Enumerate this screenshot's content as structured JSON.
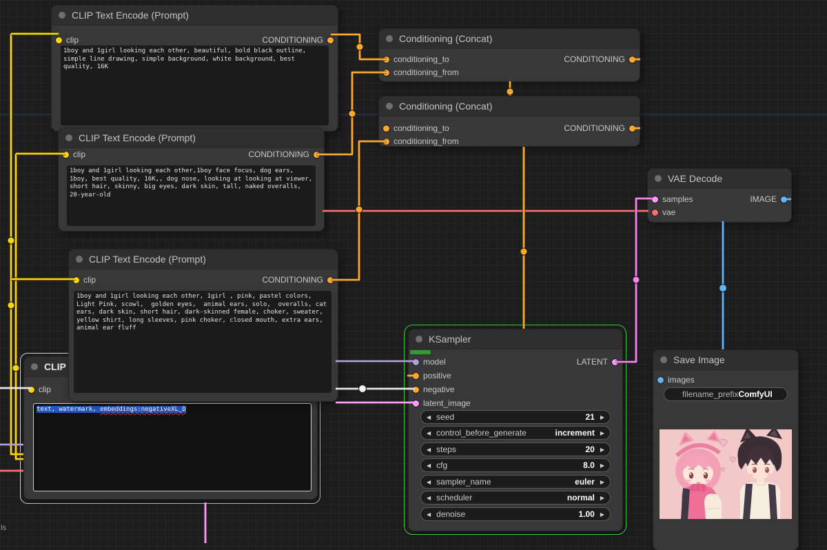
{
  "canvas": {
    "corner_text": "ls"
  },
  "icons": {
    "arrow_left": "◀",
    "arrow_right": "▶"
  },
  "colors": {
    "clip_port": "#FFD500",
    "conditioning_port": "#FFA931",
    "model_port": "#B39DDB",
    "latent_port": "#FF9CF9",
    "vae_port": "#FF6E6E",
    "image_port": "#64B5F6",
    "selected_node_outline": "#d9d9d9",
    "running_node_outline": "#3dc83d",
    "progress_bar": "#2f9e2f",
    "link_highlight": "#e8e8e8"
  },
  "nodes": {
    "clip1": {
      "title": "CLIP Text Encode (Prompt)",
      "input": "clip",
      "output": "CONDITIONING",
      "text": "1boy and 1girl looking each other, beautiful, bold black outline, simple line drawing, simple background, white background, best quality, 16K"
    },
    "clip2": {
      "title": "CLIP Text Encode (Prompt)",
      "input": "clip",
      "output": "CONDITIONING",
      "text": "1boy and 1girl looking each other,1boy face focus, dog ears, 1boy, best quality, 16K,, dog nose, looking at looking at viewer, short hair, skinny, big eyes, dark skin, tall, naked overalls, 20-year-old"
    },
    "clip3": {
      "title": "CLIP Text Encode (Prompt)",
      "input": "clip",
      "output": "CONDITIONING",
      "text": "1boy and 1girl looking each other, 1girl , pink, pastel colors, Light Pink, scowl,  golden eyes,  animal ears, solo,  overalls, cat ears, dark skin, short hair, dark-skinned female, choker, sweater, yellow shirt, long sleeves, pink choker, closed mouth, extra ears, animal ear fluff"
    },
    "clip4": {
      "title": "CLIP T",
      "input": "clip",
      "text_part1": "text, watermark, ",
      "text_part2": "embeddings:negativeXL_D"
    },
    "concat1": {
      "title": "Conditioning (Concat)",
      "input_to": "conditioning_to",
      "input_from": "conditioning_from",
      "output": "CONDITIONING"
    },
    "concat2": {
      "title": "Conditioning (Concat)",
      "input_to": "conditioning_to",
      "input_from": "conditioning_from",
      "output": "CONDITIONING"
    },
    "vae_decode": {
      "title": "VAE Decode",
      "input_samples": "samples",
      "input_vae": "vae",
      "output": "IMAGE"
    },
    "ksampler": {
      "title": "KSampler",
      "input_model": "model",
      "input_positive": "positive",
      "input_negative": "negative",
      "input_latent": "latent_image",
      "output": "LATENT",
      "widgets": [
        {
          "label": "seed",
          "value": "21"
        },
        {
          "label": "control_before_generate",
          "value": "increment"
        },
        {
          "label": "steps",
          "value": "20"
        },
        {
          "label": "cfg",
          "value": "8.0"
        },
        {
          "label": "sampler_name",
          "value": "euler"
        },
        {
          "label": "scheduler",
          "value": "normal"
        },
        {
          "label": "denoise",
          "value": "1.00"
        }
      ]
    },
    "save_image": {
      "title": "Save Image",
      "input": "images",
      "widget": {
        "label": "filename_prefix",
        "value": "ComfyUI"
      }
    }
  }
}
